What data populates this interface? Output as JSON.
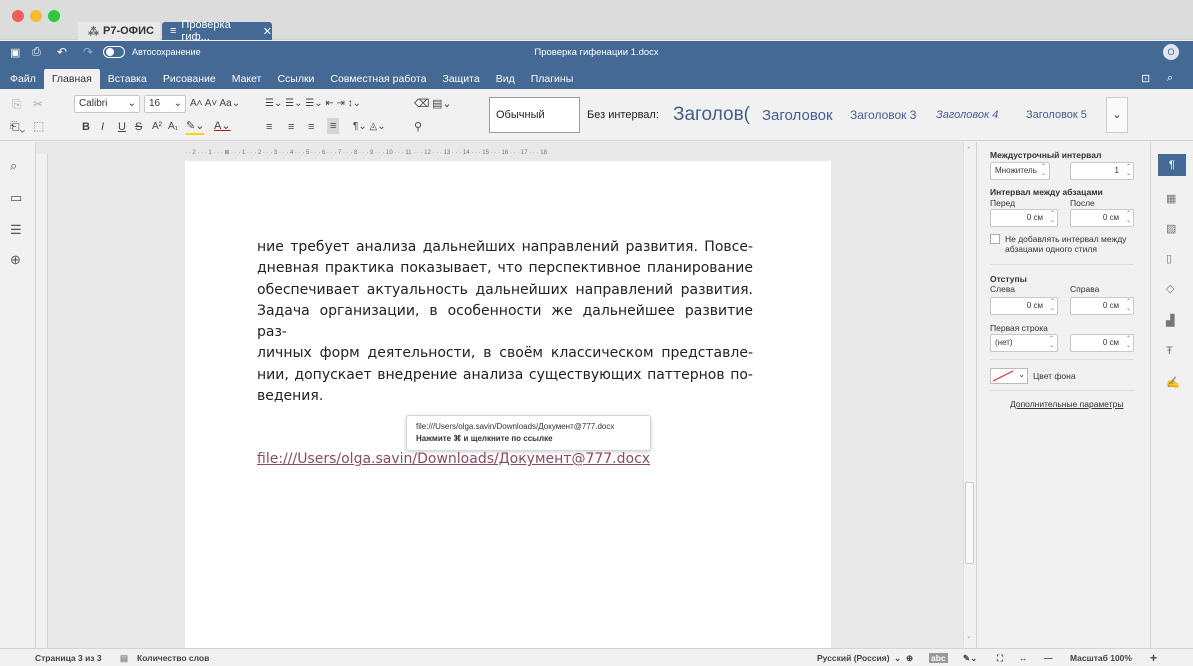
{
  "window": {
    "app_tab": "Р7-ОФИС",
    "doc_tab": "Проверка гиф...",
    "title": "Проверка гифенации 1.docx",
    "autosave_label": "Автосохранение",
    "user_initial": "O"
  },
  "menu": {
    "items": [
      "Файл",
      "Главная",
      "Вставка",
      "Рисование",
      "Макет",
      "Ссылки",
      "Совместная работа",
      "Защита",
      "Вид",
      "Плагины"
    ],
    "active_index": 1
  },
  "toolbar": {
    "font_name": "Calibri",
    "font_size": "16",
    "styles": [
      "Обычный",
      "Без интервал:",
      "Заголов(",
      "Заголовок",
      "Заголовок 3",
      "Заголовок 4",
      "Заголовок 5"
    ]
  },
  "ruler": {
    "marks": "· · 2 · · · 1 · · · ⊠ · · · 1 · · · 2 · · · 3 · · · 4 · · · 5 · · · 6 · · · 7 · · · 8 · · · 9 · · · 10 · · · 11 · · · 12 · · · 13 · · · 14 · · · 15 · · · 16 · · · 17 · · · 18"
  },
  "document": {
    "paragraph_lines": [
      "ние требует анализа дальнейших направлений развития. Повсе-",
      "дневная практика показывает, что перспективное планирование",
      "обеспечивает актуальность дальнейших направлений развития.",
      "Задача организации, в особенности же дальнейшее развитие раз-",
      "личных форм деятельности, в своём классическом представле-",
      "нии, допускает внедрение анализа существующих паттернов по-",
      "ведения."
    ],
    "link_text": "file:///Users/olga.savin/Downloads/Документ@777.docx",
    "tooltip": {
      "url": "file:///Users/olga.savin/Downloads/Документ@777.docx",
      "hint": "Нажмите ⌘ и щелкните по ссылке"
    }
  },
  "paragraph_panel": {
    "line_spacing_title": "Междустрочный интервал",
    "line_spacing_mode": "Множитель",
    "line_spacing_value": "1",
    "para_spacing_title": "Интервал между абзацами",
    "before_label": "Перед",
    "after_label": "После",
    "before_value": "0 см",
    "after_value": "0 см",
    "no_spacing_checkbox": "Не добавлять интервал между абзацами одного стиля",
    "indents_title": "Отступы",
    "left_label": "Слева",
    "right_label": "Справа",
    "left_value": "0 см",
    "right_value": "0 см",
    "first_line_label": "Первая строка",
    "first_line_mode": "(нет)",
    "first_line_value": "0 см",
    "background_color_label": "Цвет фона",
    "advanced_link": "Дополнительные параметры"
  },
  "statusbar": {
    "page_info": "Страница 3 из 3",
    "word_count": "Количество слов",
    "language": "Русский (Россия)",
    "zoom": "Масштаб 100%"
  },
  "colors": {
    "header_blue": "#446995",
    "link_color": "#8a4a64",
    "style_text": "#445e8c"
  }
}
